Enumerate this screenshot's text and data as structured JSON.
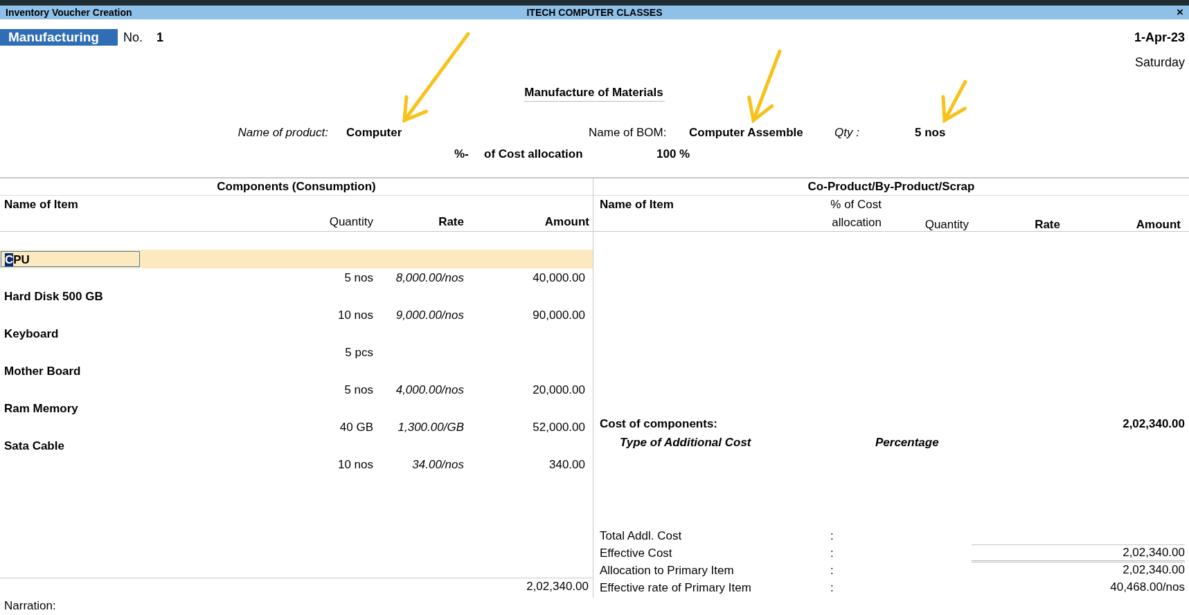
{
  "window": {
    "title": "Inventory Voucher Creation",
    "company": "ITECH COMPUTER CLASSES",
    "close": "×"
  },
  "voucher": {
    "type": "Manufacturing",
    "number_label": "No.",
    "number": "1",
    "date": "1-Apr-23",
    "day": "Saturday"
  },
  "section_title": "Manufacture of Materials",
  "product": {
    "label": "Name of product:",
    "value": "Computer",
    "bom_label": "Name of BOM:",
    "bom": "Computer Assemble",
    "qty_label": "Qty :",
    "qty": "5 nos",
    "alloc_prefix": "%-",
    "alloc_label": "of Cost allocation",
    "alloc": "100 %"
  },
  "components": {
    "title": "Components (Consumption)",
    "columns": [
      {
        "label": "Name of Item",
        "kind": "bold"
      },
      {
        "label": "Quantity",
        "kind": "plain"
      },
      {
        "label": "Rate",
        "kind": "bold"
      },
      {
        "label": "Amount",
        "kind": "bold"
      }
    ],
    "rows": [
      {
        "name": "CPU",
        "quantity": "5 nos",
        "rate": "8,000.00/nos",
        "amount": "40,000.00",
        "selected": true
      },
      {
        "name": "Hard Disk 500 GB",
        "quantity": "10 nos",
        "rate": "9,000.00/nos",
        "amount": "90,000.00",
        "selected": false
      },
      {
        "name": "Keyboard",
        "quantity": "5 pcs",
        "selected": false
      },
      {
        "name": "Mother Board",
        "quantity": "5 nos",
        "rate": "4,000.00/nos",
        "amount": "20,000.00",
        "selected": false
      },
      {
        "name": "Ram Memory",
        "quantity": "40 GB",
        "rate": "1,300.00/GB",
        "amount": "52,000.00",
        "selected": false
      },
      {
        "name": "Sata Cable",
        "quantity": "10 nos",
        "rate": "34.00/nos",
        "amount": "340.00",
        "selected": false
      }
    ],
    "total": "2,02,340.00"
  },
  "by_products": {
    "title": "Co-Product/By-Product/Scrap",
    "columns": [
      {
        "label": "Name of Item",
        "kind": "bold"
      },
      {
        "label": "% of Cost allocation",
        "kind": "plain"
      },
      {
        "label": "Quantity",
        "kind": "plain"
      },
      {
        "label": "Rate",
        "kind": "bold"
      },
      {
        "label": "Amount",
        "kind": "bold"
      }
    ],
    "cost_label": "Cost of components:",
    "cost_value": "2,02,340.00",
    "additional_cost_columns": [
      "Type of Additional Cost",
      "Percentage"
    ],
    "summary": [
      {
        "label": "Total Addl. Cost",
        "colon": ":"
      },
      {
        "label": "Effective Cost",
        "colon": ":",
        "value": "2,02,340.00",
        "kind": "ruled"
      },
      {
        "label": "Allocation to Primary Item",
        "colon": ":",
        "value": "2,02,340.00",
        "kind": "double-ruled"
      },
      {
        "label": "Effective rate of Primary Item",
        "colon": ":",
        "value": "40,468.00/nos"
      }
    ]
  },
  "narration": {
    "label": "Narration:"
  }
}
